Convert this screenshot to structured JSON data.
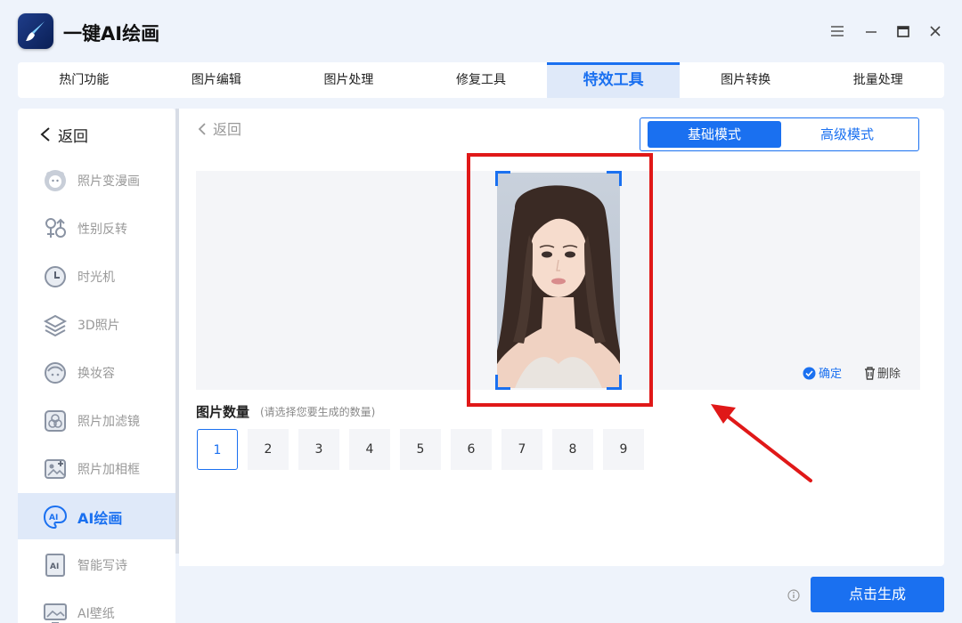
{
  "app": {
    "title": "一键AI绘画"
  },
  "tabs": [
    {
      "label": "热门功能"
    },
    {
      "label": "图片编辑"
    },
    {
      "label": "图片处理"
    },
    {
      "label": "修复工具"
    },
    {
      "label": "特效工具",
      "active": true
    },
    {
      "label": "图片转换"
    },
    {
      "label": "批量处理"
    }
  ],
  "sidebar": {
    "back_label": "返回",
    "items": [
      {
        "label": "照片变漫画",
        "icon": "cartoon-face-icon"
      },
      {
        "label": "性别反转",
        "icon": "gender-icon"
      },
      {
        "label": "时光机",
        "icon": "clock-icon"
      },
      {
        "label": "3D照片",
        "icon": "layers-icon"
      },
      {
        "label": "换妆容",
        "icon": "makeup-face-icon"
      },
      {
        "label": "照片加滤镜",
        "icon": "filter-icon"
      },
      {
        "label": "照片加相框",
        "icon": "frame-icon"
      },
      {
        "label": "AI绘画",
        "icon": "ai-palette-icon",
        "active": true
      },
      {
        "label": "智能写诗",
        "icon": "ai-document-icon"
      },
      {
        "label": "AI壁纸",
        "icon": "wallpaper-icon"
      }
    ]
  },
  "main": {
    "back_label": "返回",
    "modes": {
      "basic": "基础模式",
      "advanced": "高级模式"
    },
    "confirm_label": "确定",
    "delete_label": "删除",
    "quantity": {
      "title": "图片数量",
      "hint": "(请选择您要生成的数量)",
      "options": [
        "1",
        "2",
        "3",
        "4",
        "5",
        "6",
        "7",
        "8",
        "9"
      ],
      "selected": "1"
    }
  },
  "footer": {
    "generate_label": "点击生成"
  },
  "colors": {
    "accent": "#1a70f0",
    "annotation": "#e01818"
  }
}
